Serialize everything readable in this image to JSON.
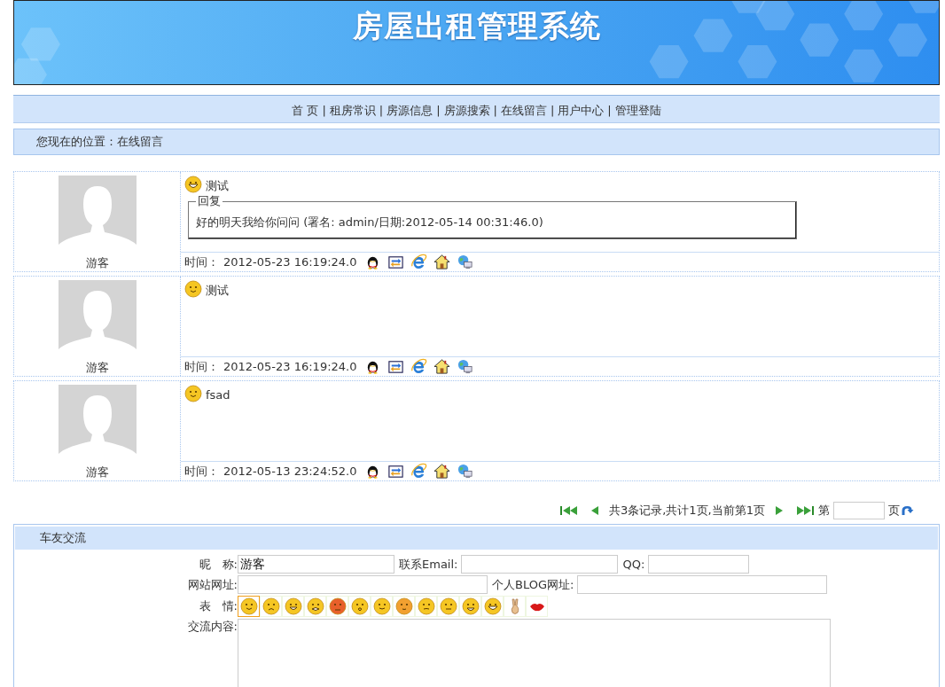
{
  "banner": {
    "title": "房屋出租管理系统"
  },
  "nav": {
    "separator": "|",
    "items": [
      "首 页",
      "租房常识",
      "房源信息",
      "房源搜索",
      "在线留言",
      "用户中心",
      "管理登陆"
    ]
  },
  "breadcrumb": "您现在的位置：在线留言",
  "messages": [
    {
      "author": "游客",
      "face": {
        "kind": "bigGrin"
      },
      "text": "测试",
      "reply": {
        "legend": "回复",
        "text": "好的明天我给你问问 (署名: admin/日期:2012-05-14 00:31:46.0)"
      },
      "time_label": "时间：",
      "time": "2012-05-23 16:19:24.0"
    },
    {
      "author": "游客",
      "face": {
        "kind": "smile"
      },
      "text": "测试",
      "time_label": "时间：",
      "time": "2012-05-23 16:19:24.0"
    },
    {
      "author": "游客",
      "face": {
        "kind": "smile"
      },
      "text": "fsad",
      "time_label": "时间：",
      "time": "2012-05-13 23:24:52.0"
    }
  ],
  "pagination": {
    "summary": "共3条记录,共计1页,当前第1页",
    "page_prefix": "第",
    "page_suffix": "页"
  },
  "form": {
    "title": "车友交流",
    "nickname_label": "昵　称:",
    "nickname_value": "游客",
    "email_label": "联系Email:",
    "qq_label": "QQ:",
    "website_label": "网站网址:",
    "blog_label": "个人BLOG网址:",
    "face_label": "表　情:",
    "content_label": "交流内容:",
    "faces": [
      {
        "kind": "smile",
        "selected": true
      },
      {
        "kind": "sad",
        "selected": false
      },
      {
        "kind": "grin",
        "selected": false
      },
      {
        "kind": "cry",
        "selected": false
      },
      {
        "kind": "angry",
        "selected": false
      },
      {
        "kind": "surprised",
        "selected": false
      },
      {
        "kind": "calm",
        "selected": false
      },
      {
        "kind": "blush",
        "selected": false
      },
      {
        "kind": "shy",
        "selected": false
      },
      {
        "kind": "squint",
        "selected": false
      },
      {
        "kind": "laugh",
        "selected": false
      },
      {
        "kind": "bigGrin",
        "selected": false
      },
      {
        "kind": "hand",
        "selected": false
      },
      {
        "kind": "lips",
        "selected": false
      }
    ]
  }
}
